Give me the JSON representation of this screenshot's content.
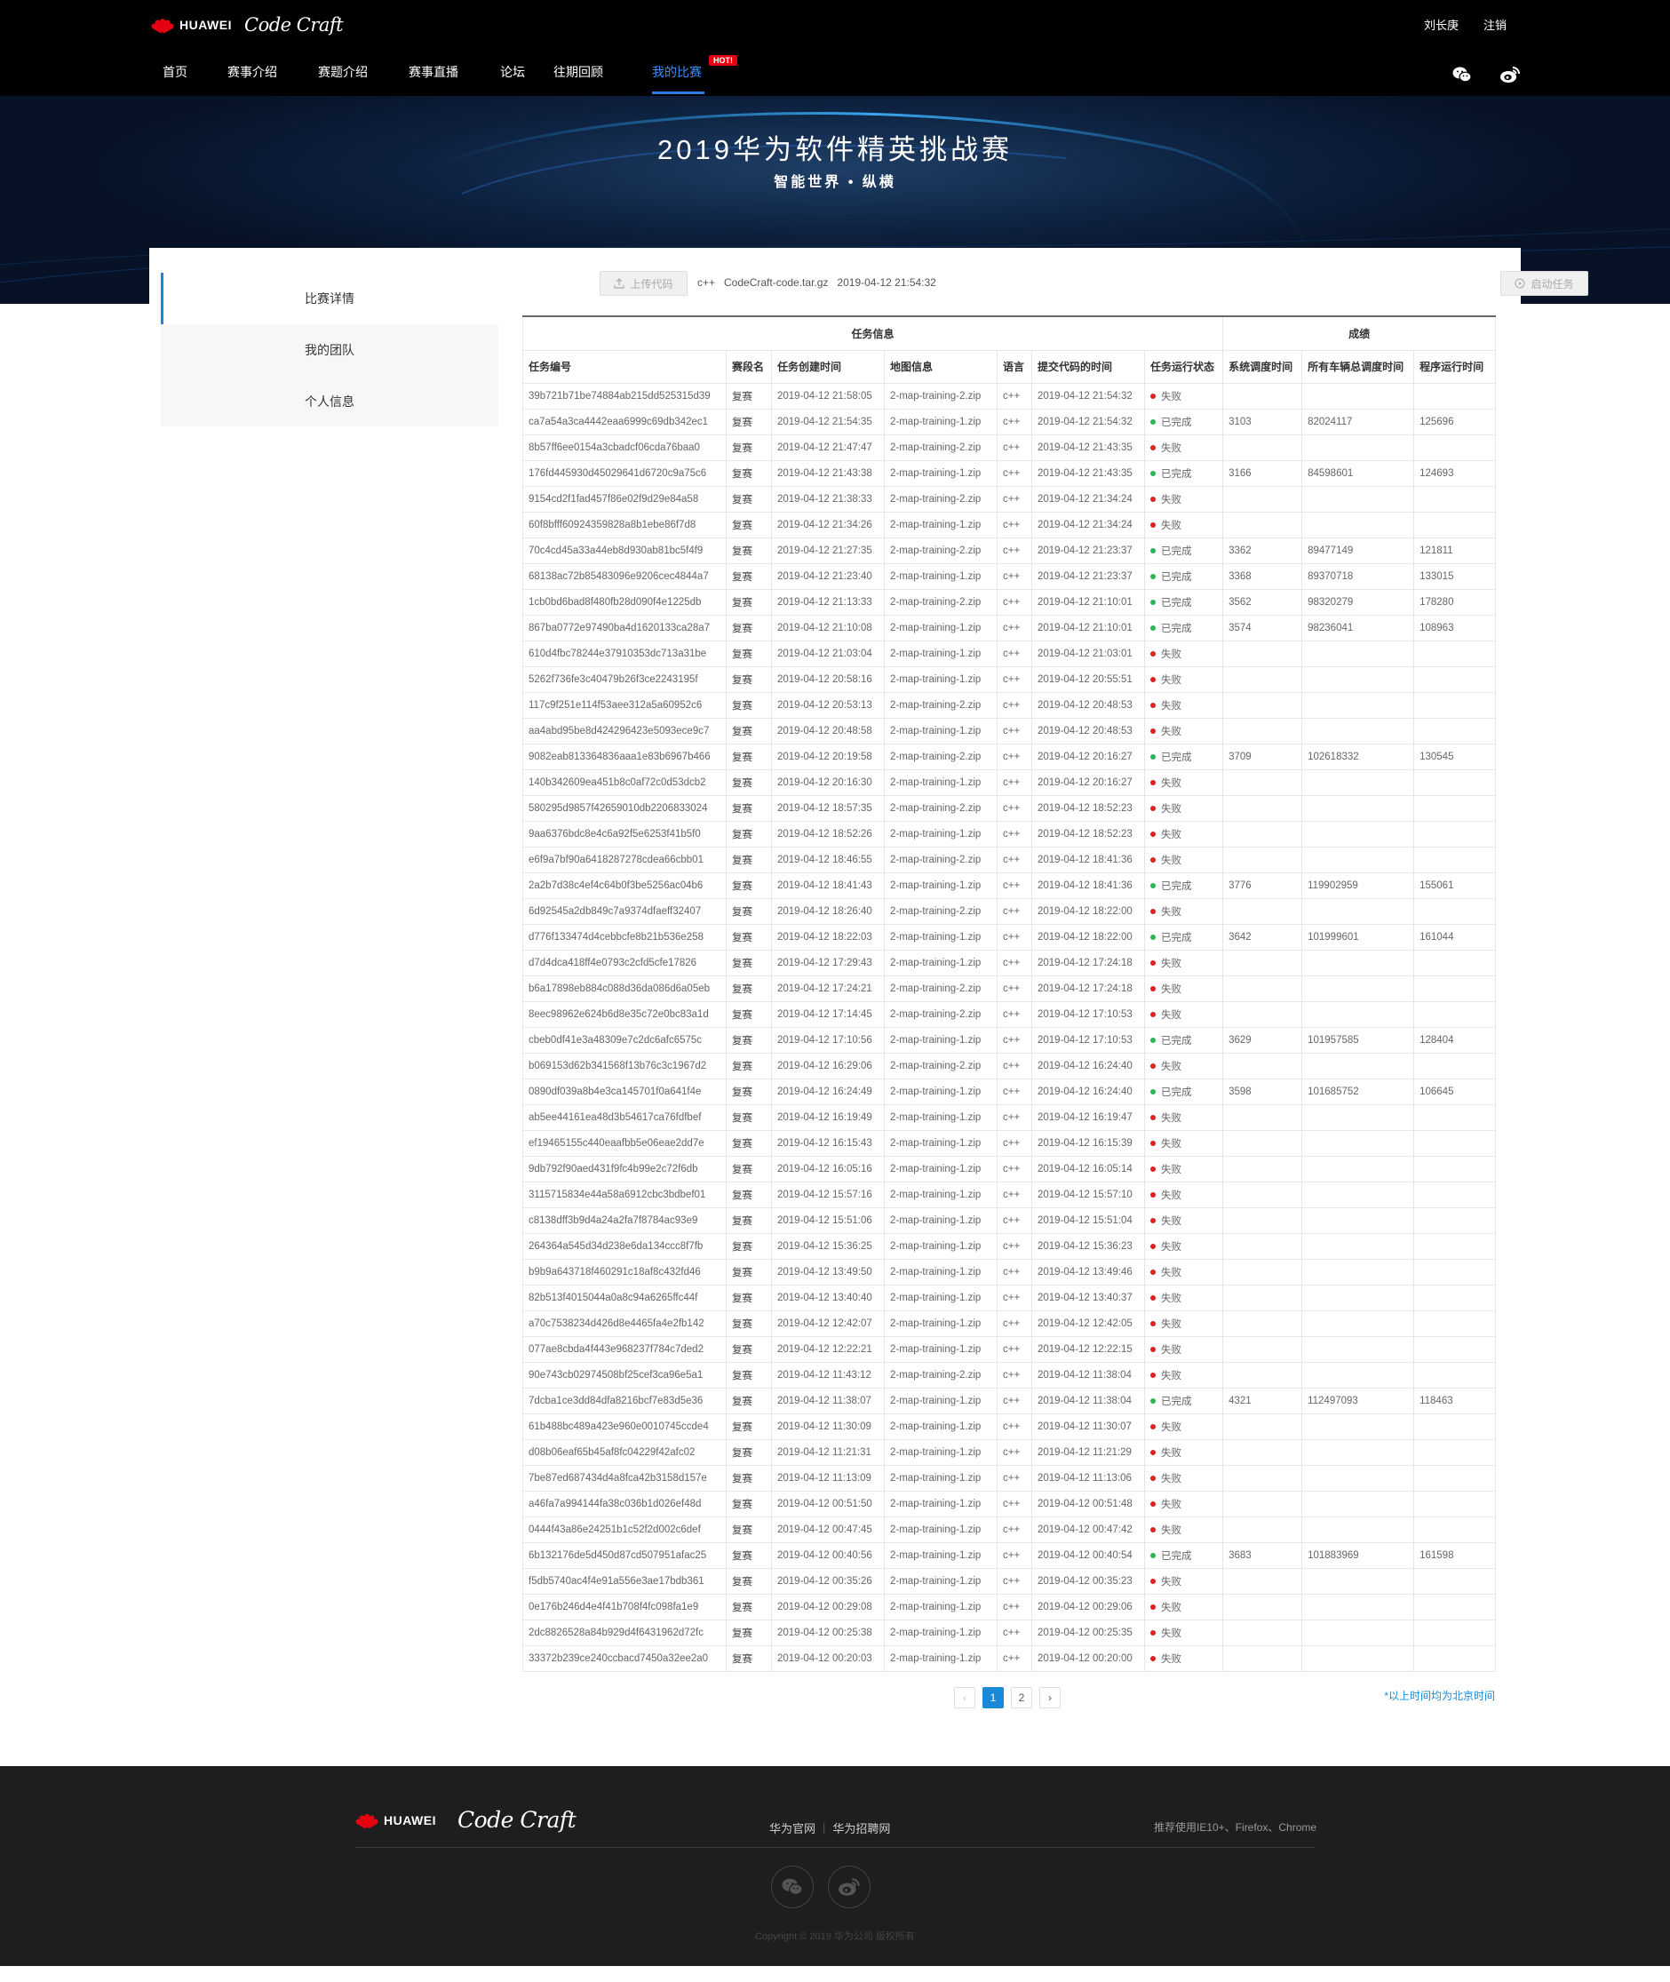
{
  "header": {
    "brand_word": "HUAWEI",
    "brand_product": "Code Craft",
    "user_name": "刘长庚",
    "logout": "注销",
    "nav": [
      {
        "label": "首页"
      },
      {
        "label": "赛事介绍"
      },
      {
        "label": "赛题介绍"
      },
      {
        "label": "赛事直播"
      },
      {
        "label": "论坛"
      },
      {
        "label": "往期回顾"
      },
      {
        "label": "我的比赛"
      }
    ],
    "hot_badge": "HOT!"
  },
  "banner": {
    "title": "2019华为软件精英挑战赛",
    "subtitle": "智能世界 • 纵横"
  },
  "sidebar": {
    "items": [
      {
        "label": "比赛详情"
      },
      {
        "label": "我的团队"
      },
      {
        "label": "个人信息"
      }
    ]
  },
  "toolbar": {
    "upload_label": "上传代码",
    "language": "c++",
    "file_name": "CodeCraft-code.tar.gz",
    "file_time": "2019-04-12 21:54:32",
    "start_label": "启动任务"
  },
  "table": {
    "group_headers": [
      "任务信息",
      "成绩"
    ],
    "columns": [
      "任务编号",
      "赛段名",
      "任务创建时间",
      "地图信息",
      "语言",
      "提交代码的时间",
      "任务运行状态",
      "系统调度时间",
      "所有车辆总调度时间",
      "程序运行时间"
    ],
    "status_colors": {
      "已完成": "#2db45a",
      "失败": "#e02020"
    },
    "rows": [
      [
        "39b721b71be74884ab215dd525315d39",
        "复赛",
        "2019-04-12 21:58:05",
        "2-map-training-2.zip",
        "c++",
        "2019-04-12 21:54:32",
        "失败",
        "",
        "",
        ""
      ],
      [
        "ca7a54a3ca4442eaa6999c69db342ec1",
        "复赛",
        "2019-04-12 21:54:35",
        "2-map-training-1.zip",
        "c++",
        "2019-04-12 21:54:32",
        "已完成",
        "3103",
        "82024117",
        "125696"
      ],
      [
        "8b57ff6ee0154a3cbadcf06cda76baa0",
        "复赛",
        "2019-04-12 21:47:47",
        "2-map-training-2.zip",
        "c++",
        "2019-04-12 21:43:35",
        "失败",
        "",
        "",
        ""
      ],
      [
        "176fd445930d45029641d6720c9a75c6",
        "复赛",
        "2019-04-12 21:43:38",
        "2-map-training-1.zip",
        "c++",
        "2019-04-12 21:43:35",
        "已完成",
        "3166",
        "84598601",
        "124693"
      ],
      [
        "9154cd2f1fad457f86e02f9d29e84a58",
        "复赛",
        "2019-04-12 21:38:33",
        "2-map-training-2.zip",
        "c++",
        "2019-04-12 21:34:24",
        "失败",
        "",
        "",
        ""
      ],
      [
        "60f8bfff60924359828a8b1ebe86f7d8",
        "复赛",
        "2019-04-12 21:34:26",
        "2-map-training-1.zip",
        "c++",
        "2019-04-12 21:34:24",
        "失败",
        "",
        "",
        ""
      ],
      [
        "70c4cd45a33a44eb8d930ab81bc5f4f9",
        "复赛",
        "2019-04-12 21:27:35",
        "2-map-training-2.zip",
        "c++",
        "2019-04-12 21:23:37",
        "已完成",
        "3362",
        "89477149",
        "121811"
      ],
      [
        "68138ac72b85483096e9206cec4844a7",
        "复赛",
        "2019-04-12 21:23:40",
        "2-map-training-1.zip",
        "c++",
        "2019-04-12 21:23:37",
        "已完成",
        "3368",
        "89370718",
        "133015"
      ],
      [
        "1cb0bd6bad8f480fb28d090f4e1225db",
        "复赛",
        "2019-04-12 21:13:33",
        "2-map-training-2.zip",
        "c++",
        "2019-04-12 21:10:01",
        "已完成",
        "3562",
        "98320279",
        "178280"
      ],
      [
        "867ba0772e97490ba4d1620133ca28a7",
        "复赛",
        "2019-04-12 21:10:08",
        "2-map-training-1.zip",
        "c++",
        "2019-04-12 21:10:01",
        "已完成",
        "3574",
        "98236041",
        "108963"
      ],
      [
        "610d4fbc78244e37910353dc713a31be",
        "复赛",
        "2019-04-12 21:03:04",
        "2-map-training-1.zip",
        "c++",
        "2019-04-12 21:03:01",
        "失败",
        "",
        "",
        ""
      ],
      [
        "5262f736fe3c40479b26f3ce2243195f",
        "复赛",
        "2019-04-12 20:58:16",
        "2-map-training-1.zip",
        "c++",
        "2019-04-12 20:55:51",
        "失败",
        "",
        "",
        ""
      ],
      [
        "117c9f251e114f53aee312a5a60952c6",
        "复赛",
        "2019-04-12 20:53:13",
        "2-map-training-2.zip",
        "c++",
        "2019-04-12 20:48:53",
        "失败",
        "",
        "",
        ""
      ],
      [
        "aa4abd95be8d424296423e5093ece9c7",
        "复赛",
        "2019-04-12 20:48:58",
        "2-map-training-1.zip",
        "c++",
        "2019-04-12 20:48:53",
        "失败",
        "",
        "",
        ""
      ],
      [
        "9082eab813364836aaa1e83b6967b466",
        "复赛",
        "2019-04-12 20:19:58",
        "2-map-training-2.zip",
        "c++",
        "2019-04-12 20:16:27",
        "已完成",
        "3709",
        "102618332",
        "130545"
      ],
      [
        "140b342609ea451b8c0af72c0d53dcb2",
        "复赛",
        "2019-04-12 20:16:30",
        "2-map-training-1.zip",
        "c++",
        "2019-04-12 20:16:27",
        "失败",
        "",
        "",
        ""
      ],
      [
        "580295d9857f42659010db2206833024",
        "复赛",
        "2019-04-12 18:57:35",
        "2-map-training-2.zip",
        "c++",
        "2019-04-12 18:52:23",
        "失败",
        "",
        "",
        ""
      ],
      [
        "9aa6376bdc8e4c6a92f5e6253f41b5f0",
        "复赛",
        "2019-04-12 18:52:26",
        "2-map-training-1.zip",
        "c++",
        "2019-04-12 18:52:23",
        "失败",
        "",
        "",
        ""
      ],
      [
        "e6f9a7bf90a6418287278cdea66cbb01",
        "复赛",
        "2019-04-12 18:46:55",
        "2-map-training-2.zip",
        "c++",
        "2019-04-12 18:41:36",
        "失败",
        "",
        "",
        ""
      ],
      [
        "2a2b7d38c4ef4c64b0f3be5256ac04b6",
        "复赛",
        "2019-04-12 18:41:43",
        "2-map-training-1.zip",
        "c++",
        "2019-04-12 18:41:36",
        "已完成",
        "3776",
        "119902959",
        "155061"
      ],
      [
        "6d92545a2db849c7a9374dfaeff32407",
        "复赛",
        "2019-04-12 18:26:40",
        "2-map-training-2.zip",
        "c++",
        "2019-04-12 18:22:00",
        "失败",
        "",
        "",
        ""
      ],
      [
        "d776f133474d4cebbcfe8b21b536e258",
        "复赛",
        "2019-04-12 18:22:03",
        "2-map-training-1.zip",
        "c++",
        "2019-04-12 18:22:00",
        "已完成",
        "3642",
        "101999601",
        "161044"
      ],
      [
        "d7d4dca418ff4e0793c2cfd5cfe17826",
        "复赛",
        "2019-04-12 17:29:43",
        "2-map-training-1.zip",
        "c++",
        "2019-04-12 17:24:18",
        "失败",
        "",
        "",
        ""
      ],
      [
        "b6a17898eb884c088d36da086d6a05eb",
        "复赛",
        "2019-04-12 17:24:21",
        "2-map-training-2.zip",
        "c++",
        "2019-04-12 17:24:18",
        "失败",
        "",
        "",
        ""
      ],
      [
        "8eec98962e624b6d8e35c72e0bc83a1d",
        "复赛",
        "2019-04-12 17:14:45",
        "2-map-training-2.zip",
        "c++",
        "2019-04-12 17:10:53",
        "失败",
        "",
        "",
        ""
      ],
      [
        "cbeb0df41e3a48309e7c2dc6afc6575c",
        "复赛",
        "2019-04-12 17:10:56",
        "2-map-training-1.zip",
        "c++",
        "2019-04-12 17:10:53",
        "已完成",
        "3629",
        "101957585",
        "128404"
      ],
      [
        "b069153d62b341568f13b76c3c1967d2",
        "复赛",
        "2019-04-12 16:29:06",
        "2-map-training-2.zip",
        "c++",
        "2019-04-12 16:24:40",
        "失败",
        "",
        "",
        ""
      ],
      [
        "0890df039a8b4e3ca145701f0a641f4e",
        "复赛",
        "2019-04-12 16:24:49",
        "2-map-training-1.zip",
        "c++",
        "2019-04-12 16:24:40",
        "已完成",
        "3598",
        "101685752",
        "106645"
      ],
      [
        "ab5ee44161ea48d3b54617ca76fdfbef",
        "复赛",
        "2019-04-12 16:19:49",
        "2-map-training-1.zip",
        "c++",
        "2019-04-12 16:19:47",
        "失败",
        "",
        "",
        ""
      ],
      [
        "ef19465155c440eaafbb5e06eae2dd7e",
        "复赛",
        "2019-04-12 16:15:43",
        "2-map-training-1.zip",
        "c++",
        "2019-04-12 16:15:39",
        "失败",
        "",
        "",
        ""
      ],
      [
        "9db792f90aed431f9fc4b99e2c72f6db",
        "复赛",
        "2019-04-12 16:05:16",
        "2-map-training-1.zip",
        "c++",
        "2019-04-12 16:05:14",
        "失败",
        "",
        "",
        ""
      ],
      [
        "3115715834e44a58a6912cbc3bdbef01",
        "复赛",
        "2019-04-12 15:57:16",
        "2-map-training-1.zip",
        "c++",
        "2019-04-12 15:57:10",
        "失败",
        "",
        "",
        ""
      ],
      [
        "c8138dff3b9d4a24a2fa7f8784ac93e9",
        "复赛",
        "2019-04-12 15:51:06",
        "2-map-training-1.zip",
        "c++",
        "2019-04-12 15:51:04",
        "失败",
        "",
        "",
        ""
      ],
      [
        "264364a545d34d238e6da134ccc8f7fb",
        "复赛",
        "2019-04-12 15:36:25",
        "2-map-training-1.zip",
        "c++",
        "2019-04-12 15:36:23",
        "失败",
        "",
        "",
        ""
      ],
      [
        "b9b9a643718f460291c18af8c432fd46",
        "复赛",
        "2019-04-12 13:49:50",
        "2-map-training-1.zip",
        "c++",
        "2019-04-12 13:49:46",
        "失败",
        "",
        "",
        ""
      ],
      [
        "82b513f4015044a0a8c94a6265ffc44f",
        "复赛",
        "2019-04-12 13:40:40",
        "2-map-training-1.zip",
        "c++",
        "2019-04-12 13:40:37",
        "失败",
        "",
        "",
        ""
      ],
      [
        "a70c7538234d426d8e4465fa4e2fb142",
        "复赛",
        "2019-04-12 12:42:07",
        "2-map-training-1.zip",
        "c++",
        "2019-04-12 12:42:05",
        "失败",
        "",
        "",
        ""
      ],
      [
        "077ae8cbda4f443e968237f784c7ded2",
        "复赛",
        "2019-04-12 12:22:21",
        "2-map-training-1.zip",
        "c++",
        "2019-04-12 12:22:15",
        "失败",
        "",
        "",
        ""
      ],
      [
        "90e743cb02974508bf25cef3ca96e5a1",
        "复赛",
        "2019-04-12 11:43:12",
        "2-map-training-2.zip",
        "c++",
        "2019-04-12 11:38:04",
        "失败",
        "",
        "",
        ""
      ],
      [
        "7dcba1ce3dd84dfa8216bcf7e83d5e36",
        "复赛",
        "2019-04-12 11:38:07",
        "2-map-training-1.zip",
        "c++",
        "2019-04-12 11:38:04",
        "已完成",
        "4321",
        "112497093",
        "118463"
      ],
      [
        "61b488bc489a423e960e0010745ccde4",
        "复赛",
        "2019-04-12 11:30:09",
        "2-map-training-1.zip",
        "c++",
        "2019-04-12 11:30:07",
        "失败",
        "",
        "",
        ""
      ],
      [
        "d08b06eaf65b45af8fc04229f42afc02",
        "复赛",
        "2019-04-12 11:21:31",
        "2-map-training-1.zip",
        "c++",
        "2019-04-12 11:21:29",
        "失败",
        "",
        "",
        ""
      ],
      [
        "7be87ed687434d4a8fca42b3158d157e",
        "复赛",
        "2019-04-12 11:13:09",
        "2-map-training-1.zip",
        "c++",
        "2019-04-12 11:13:06",
        "失败",
        "",
        "",
        ""
      ],
      [
        "a46fa7a994144fa38c036b1d026ef48d",
        "复赛",
        "2019-04-12 00:51:50",
        "2-map-training-1.zip",
        "c++",
        "2019-04-12 00:51:48",
        "失败",
        "",
        "",
        ""
      ],
      [
        "0444f43a86e24251b1c52f2d002c6def",
        "复赛",
        "2019-04-12 00:47:45",
        "2-map-training-1.zip",
        "c++",
        "2019-04-12 00:47:42",
        "失败",
        "",
        "",
        ""
      ],
      [
        "6b132176de5d450d87cd507951afac25",
        "复赛",
        "2019-04-12 00:40:56",
        "2-map-training-1.zip",
        "c++",
        "2019-04-12 00:40:54",
        "已完成",
        "3683",
        "101883969",
        "161598"
      ],
      [
        "f5db5740ac4f4e91a556e3ae17bdb361",
        "复赛",
        "2019-04-12 00:35:26",
        "2-map-training-1.zip",
        "c++",
        "2019-04-12 00:35:23",
        "失败",
        "",
        "",
        ""
      ],
      [
        "0e176b246d4e4f41b708f4fc098fa1e9",
        "复赛",
        "2019-04-12 00:29:08",
        "2-map-training-1.zip",
        "c++",
        "2019-04-12 00:29:06",
        "失败",
        "",
        "",
        ""
      ],
      [
        "2dc8826528a84b929d4f6431962d72fc",
        "复赛",
        "2019-04-12 00:25:38",
        "2-map-training-1.zip",
        "c++",
        "2019-04-12 00:25:35",
        "失败",
        "",
        "",
        ""
      ],
      [
        "33372b239ce240ccbacd7450a32ee2a0",
        "复赛",
        "2019-04-12 00:20:03",
        "2-map-training-1.zip",
        "c++",
        "2019-04-12 00:20:00",
        "失败",
        "",
        "",
        ""
      ]
    ]
  },
  "pagination": {
    "prev": "‹",
    "pages": [
      "1",
      "2"
    ],
    "current": "1",
    "next": "›"
  },
  "note": "*以上时间均为北京时间",
  "footer": {
    "brand_word": "HUAWEI",
    "brand_product": "Code Craft",
    "links": [
      "华为官网",
      "华为招聘网"
    ],
    "browser_tip": "推荐使用IE10+、Firefox、Chrome",
    "copyright": "Copyright © 2019 华为公司  版权所有"
  },
  "icons": {
    "social": [
      "wechat-icon",
      "weibo-icon"
    ],
    "upload": "upload-icon",
    "start": "play-circle-icon"
  }
}
